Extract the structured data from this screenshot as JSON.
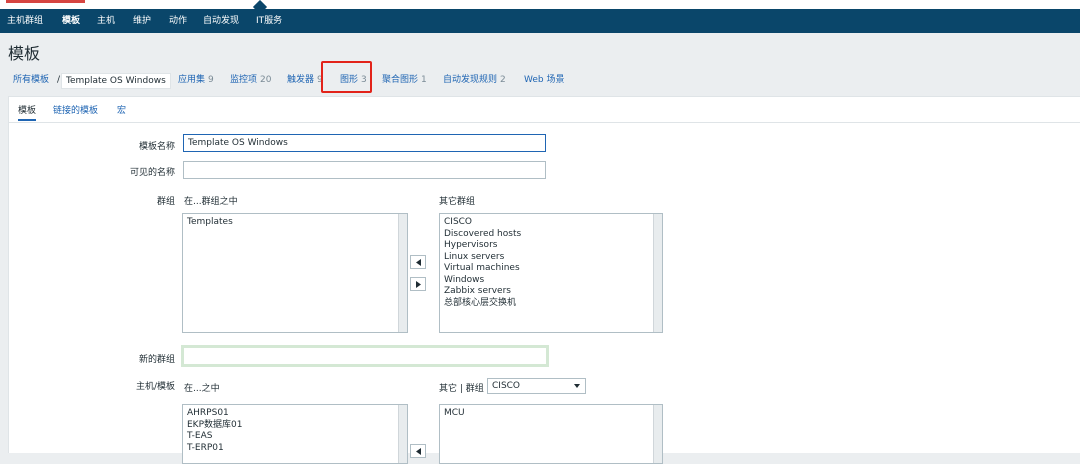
{
  "nav": {
    "items": [
      {
        "label": "主机群组",
        "active": false
      },
      {
        "label": "模板",
        "active": true
      },
      {
        "label": "主机",
        "active": false
      },
      {
        "label": "维护",
        "active": false
      },
      {
        "label": "动作",
        "active": false
      },
      {
        "label": "自动发现",
        "active": false
      },
      {
        "label": "IT服务",
        "active": false
      }
    ]
  },
  "page_title": "模板",
  "breadcrumb": {
    "all_templates": "所有模板",
    "separator": "/",
    "current": "Template OS Windows",
    "links": [
      {
        "label": "应用集",
        "count": "9"
      },
      {
        "label": "监控项",
        "count": "20"
      },
      {
        "label": "触发器",
        "count": "9"
      },
      {
        "label": "图形",
        "count": "3"
      },
      {
        "label": "聚合图形",
        "count": "1"
      },
      {
        "label": "自动发现规则",
        "count": "2"
      },
      {
        "label": "Web 场景",
        "count": ""
      }
    ]
  },
  "tabs": [
    {
      "label": "模板",
      "active": true
    },
    {
      "label": "链接的模板",
      "active": false
    },
    {
      "label": "宏",
      "active": false
    }
  ],
  "form": {
    "template_name": {
      "label": "模板名称",
      "value": "Template OS Windows"
    },
    "visible_name": {
      "label": "可见的名称",
      "value": ""
    },
    "groups": {
      "label": "群组",
      "in_label": "在...群组之中",
      "other_label": "其它群组",
      "in_items": [
        "Templates"
      ],
      "other_items": [
        "CISCO",
        "Discovered hosts",
        "Hypervisors",
        "Linux servers",
        "Virtual machines",
        "Windows",
        "Zabbix servers",
        "总部核心层交换机"
      ]
    },
    "new_group": {
      "label": "新的群组",
      "value": ""
    },
    "hosts": {
      "label": "主机/模板",
      "in_label": "在...之中",
      "other_label": "其它 | 群组",
      "group_select": "CISCO",
      "in_items": [
        "AHRPS01",
        "EKP数据库01",
        "T-EAS",
        "T-ERP01"
      ],
      "other_items": [
        "MCU"
      ]
    }
  },
  "colors": {
    "nav_bg": "#0a466a",
    "link": "#1f65b3",
    "highlight": "#e2231a",
    "page_bg": "#ebeef0"
  }
}
